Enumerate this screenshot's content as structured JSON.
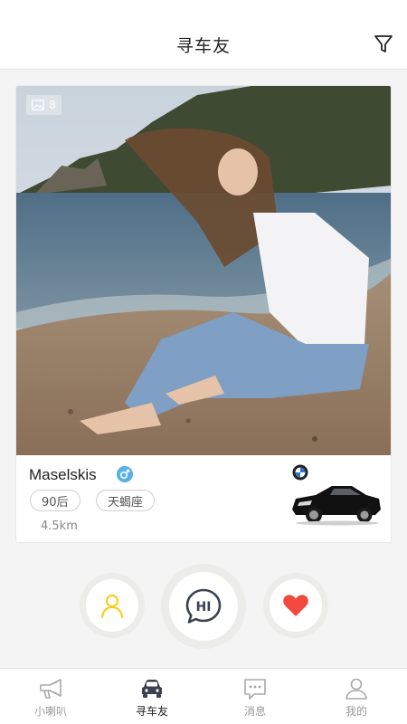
{
  "header": {
    "title": "寻车友",
    "filter_icon": "filter-icon"
  },
  "card": {
    "photo_count": "8",
    "photo_count_icon": "image-icon",
    "name": "Maselskis",
    "gender": "male",
    "tags": [
      "90后",
      "天蝎座"
    ],
    "distance": "4.5km",
    "car_brand_icon": "bmw-logo",
    "car_image": "car-image"
  },
  "actions": {
    "profile_icon": "person-icon",
    "hi_label": "HI",
    "like_icon": "heart-icon"
  },
  "tabbar": {
    "items": [
      {
        "label": "小喇叭",
        "icon": "megaphone-icon",
        "active": false
      },
      {
        "label": "寻车友",
        "icon": "car-icon",
        "active": true
      },
      {
        "label": "消息",
        "icon": "message-icon",
        "active": false
      },
      {
        "label": "我的",
        "icon": "user-icon",
        "active": false
      }
    ]
  },
  "colors": {
    "accent_yellow": "#f5d020",
    "heart_red": "#f2493d",
    "gender_blue": "#5ab0e8",
    "hi_dark": "#3b4150"
  }
}
